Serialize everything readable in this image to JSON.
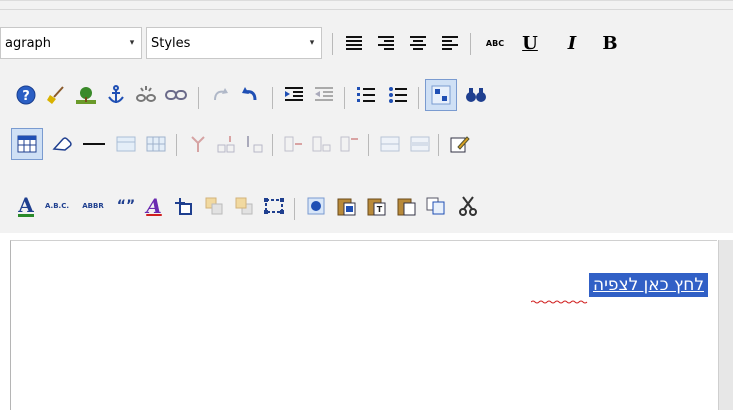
{
  "toolbar": {
    "format_select": {
      "value": "agraph",
      "arrow": "▾"
    },
    "styles_select": {
      "value": "Styles",
      "arrow": "▾"
    },
    "row1_text_buttons": {
      "abc_label": "ABC",
      "underline_label": "U",
      "italic_label": "I",
      "bold_label": "B"
    },
    "row4_text_buttons": {
      "font_color_label": "A",
      "acronym_label": "A.B.C.",
      "abbr_label": "ABBR",
      "quote_label": "“”",
      "style_label": "A"
    }
  },
  "editor": {
    "selected_text": "לחץ כאן לצפיה"
  },
  "colors": {
    "toolbar_bg": "#f2f2f2",
    "selection": "#3160c6",
    "accent_blue": "#1f4fb4",
    "font_color_underline": "#2a8a2a"
  }
}
